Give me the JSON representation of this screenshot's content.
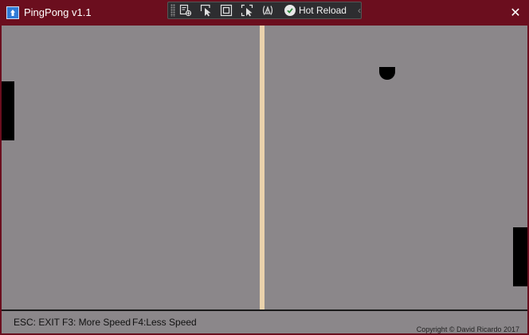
{
  "window": {
    "title": "PingPong v1.1",
    "close_glyph": "✕",
    "title_bar_color": "#6b0e1e"
  },
  "debug_toolbar": {
    "tools": [
      {
        "icon": "live-visual-tree-icon"
      },
      {
        "icon": "select-element-icon"
      },
      {
        "icon": "display-layout-adorners-icon"
      },
      {
        "icon": "track-focused-element-icon"
      },
      {
        "icon": "binding-failures-icon"
      }
    ],
    "hot_reload_label": "Hot Reload",
    "collapse_glyph": "‹"
  },
  "game": {
    "background": "#8b878a",
    "net_color": "#ead2ac",
    "paddle_color": "#000000",
    "ball_color": "#000000"
  },
  "footer": {
    "hints": {
      "esc": "ESC: EXIT",
      "f3": "F3: More Speed",
      "f4": "F4:Less Speed"
    },
    "copyright": "Copyright © David Ricardo 2017"
  }
}
